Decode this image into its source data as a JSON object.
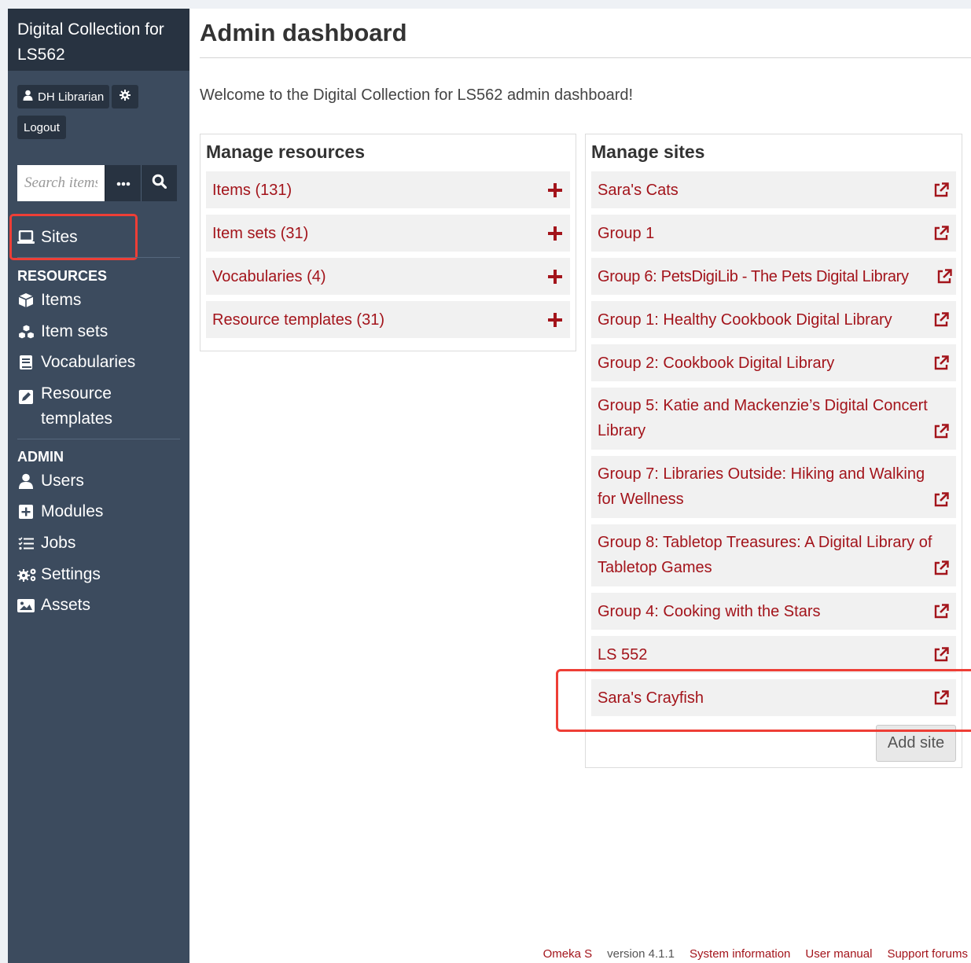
{
  "sidebar": {
    "brand": "Digital Collection for LS562",
    "user_label": "DH Librarian",
    "logout_label": "Logout",
    "search_placeholder": "Search items",
    "sites_label": "Sites",
    "resources_heading": "RESOURCES",
    "resources": [
      {
        "label": "Items",
        "icon": "cube-icon"
      },
      {
        "label": "Item sets",
        "icon": "cubes-icon"
      },
      {
        "label": "Vocabularies",
        "icon": "book-icon"
      },
      {
        "label": "Resource templates",
        "icon": "edit-icon"
      }
    ],
    "admin_heading": "ADMIN",
    "admin": [
      {
        "label": "Users",
        "icon": "user-icon"
      },
      {
        "label": "Modules",
        "icon": "plus-square-icon"
      },
      {
        "label": "Jobs",
        "icon": "tasks-icon"
      },
      {
        "label": "Settings",
        "icon": "cogs-icon"
      },
      {
        "label": "Assets",
        "icon": "image-icon"
      }
    ]
  },
  "main": {
    "title": "Admin dashboard",
    "welcome": "Welcome to the Digital Collection for LS562 admin dashboard!",
    "resources_panel": {
      "heading": "Manage resources",
      "rows": [
        "Items (131)",
        "Item sets (31)",
        "Vocabularies (4)",
        "Resource templates (31)"
      ]
    },
    "sites_panel": {
      "heading": "Manage sites",
      "rows": [
        "Sara's Cats",
        "Group 1",
        "Group 6: PetsDigiLib - The Pets Digital Library",
        "Group 1: Healthy Cookbook Digital Library",
        "Group 2: Cookbook Digital Library",
        "Group 5: Katie and Mackenzie’s Digital Concert Library",
        "Group 7: Libraries Outside: Hiking and Walking for Wellness",
        "Group 8: Tabletop Treasures: A Digital Library of Tabletop Games",
        "Group 4: Cooking with the Stars",
        "LS 552",
        "Sara's Crayfish"
      ],
      "add_label": "Add site"
    }
  },
  "footer": {
    "brand": "Omeka S",
    "version": "version 4.1.1",
    "links": [
      "System information",
      "User manual",
      "Support forums"
    ]
  },
  "colors": {
    "sidebar_bg": "#3c4b5e",
    "sidebar_dark": "#283341",
    "link_red": "#a3141b",
    "highlight": "#ee3e36"
  }
}
